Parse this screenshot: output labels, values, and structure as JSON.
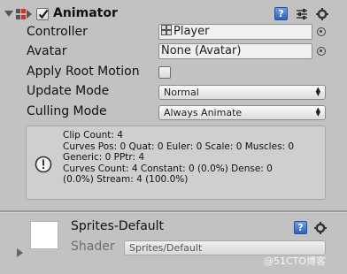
{
  "header": {
    "title": "Animator",
    "enabled": true,
    "icons": [
      "animator-component-icon",
      "help-icon",
      "preset-settings-icon",
      "gear-icon"
    ]
  },
  "properties": {
    "controller": {
      "label": "Controller",
      "value": "Player",
      "icon": "animator-controller-icon"
    },
    "avatar": {
      "label": "Avatar",
      "value": "None (Avatar)"
    },
    "apply_root_motion": {
      "label": "Apply Root Motion",
      "checked": false
    },
    "update_mode": {
      "label": "Update Mode",
      "value": "Normal"
    },
    "culling_mode": {
      "label": "Culling Mode",
      "value": "Always Animate"
    }
  },
  "info": {
    "icon": "info-icon",
    "lines": [
      "Clip Count: 4",
      "Curves Pos: 0 Quat: 0 Euler: 0 Scale: 0 Muscles: 0",
      "Generic: 0 PPtr: 4",
      "Curves Count: 4 Constant: 0 (0.0%) Dense: 0",
      "(0.0%) Stream: 4 (100.0%)"
    ]
  },
  "material": {
    "name": "Sprites-Default",
    "shader_label": "Shader",
    "shader_value": "Sprites/Default"
  },
  "watermark": "@51CTO博客",
  "colors": {
    "panel_bg": "#c2c2c2",
    "help_blue": "#2d62b6",
    "checkbox_check": "#1a1a1a"
  }
}
